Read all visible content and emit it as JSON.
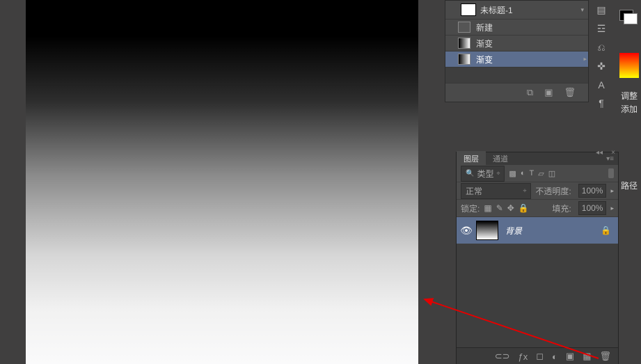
{
  "document": {
    "title": "未标题-1"
  },
  "history": {
    "items": [
      {
        "label": "新建"
      },
      {
        "label": "渐变"
      },
      {
        "label": "渐变",
        "selected": true
      }
    ],
    "footer_icons": [
      "◧",
      "📷",
      "🗑"
    ]
  },
  "side": {
    "adjust": "调整",
    "add": "添加",
    "path": "路径"
  },
  "layers": {
    "tab1": "图层",
    "tab2": "通道",
    "filter_label": "类型",
    "blend_mode": "正常",
    "opacity_label": "不透明度:",
    "opacity_value": "100%",
    "lock_label": "锁定:",
    "fill_label": "填充:",
    "fill_value": "100%",
    "layer_name": "背景"
  }
}
